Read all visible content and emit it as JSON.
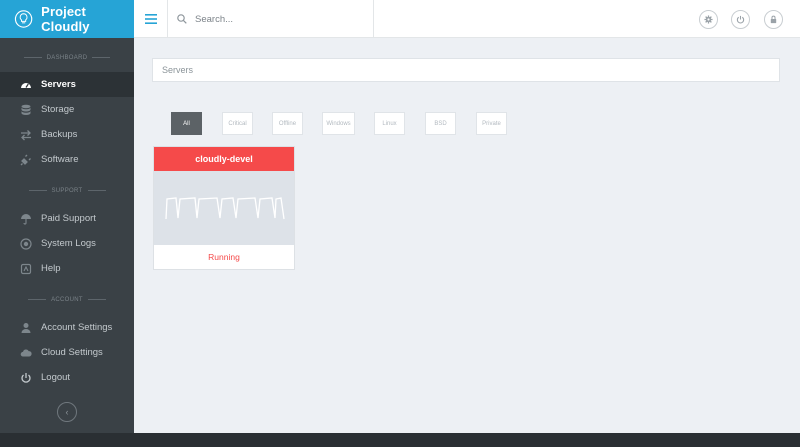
{
  "app": {
    "brand_name": "Project Cloudly",
    "accent": "#26a4d6"
  },
  "sidebar": {
    "sections": [
      {
        "label": "DASHBOARD"
      },
      {
        "label": "SUPPORT"
      },
      {
        "label": "ACCOUNT"
      }
    ],
    "items": [
      {
        "label": "Servers",
        "icon": "dashboard-icon",
        "active": true
      },
      {
        "label": "Storage",
        "icon": "database-icon"
      },
      {
        "label": "Backups",
        "icon": "exchange-icon"
      },
      {
        "label": "Software",
        "icon": "plug-icon"
      },
      {
        "label": "Paid Support",
        "icon": "umbrella-icon"
      },
      {
        "label": "System Logs",
        "icon": "log-icon"
      },
      {
        "label": "Help",
        "icon": "help-icon"
      },
      {
        "label": "Account Settings",
        "icon": "user-icon"
      },
      {
        "label": "Cloud Settings",
        "icon": "cloud-icon"
      },
      {
        "label": "Logout",
        "icon": "power-icon"
      }
    ],
    "collapse_glyph": "‹"
  },
  "topbar": {
    "search_placeholder": "Search...",
    "icons": [
      "settings-icon",
      "power-icon",
      "lock-icon"
    ]
  },
  "main": {
    "breadcrumb": "Servers",
    "filters": [
      "All",
      "Critical",
      "Offline",
      "Windows",
      "Linux",
      "BSD",
      "Private"
    ],
    "active_filter": "All",
    "servers": [
      {
        "name": "cloudly-devel",
        "status": "Running",
        "status_color": "#f54a4a"
      }
    ]
  }
}
